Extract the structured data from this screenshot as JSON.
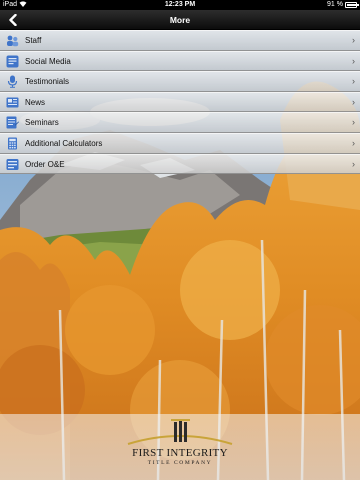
{
  "status_bar": {
    "carrier": "iPad",
    "wifi_icon": "wifi-icon",
    "time": "12:23 PM",
    "battery_text": "91 %",
    "battery_level": 0.91
  },
  "nav_bar": {
    "title": "More",
    "back_icon": "back-arrow-icon"
  },
  "menu": {
    "items": [
      {
        "label": "Staff",
        "icon": "staff-icon"
      },
      {
        "label": "Social Media",
        "icon": "social-media-icon"
      },
      {
        "label": "Testimonials",
        "icon": "testimonials-icon"
      },
      {
        "label": "News",
        "icon": "news-icon"
      },
      {
        "label": "Seminars",
        "icon": "seminars-icon"
      },
      {
        "label": "Additional Calculators",
        "icon": "calculators-icon"
      },
      {
        "label": "Order O&E",
        "icon": "order-icon"
      }
    ],
    "chevron_icon": "chevron-right-icon"
  },
  "footer": {
    "logo_name": "FIRST INTEGRITY",
    "logo_subtitle": "TITLE COMPANY"
  },
  "colors": {
    "nav_bar": "#1c1c1c",
    "menu_row": "#dcdcdc",
    "icon_blue": "#3f74c9",
    "logo_gold": "#c9a43a",
    "foliage_orange": "#e39a2a"
  }
}
